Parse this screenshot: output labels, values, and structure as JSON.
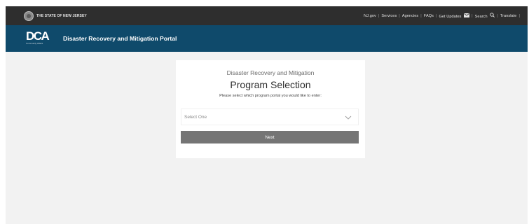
{
  "top_bar": {
    "state_name": "The State of New Jersey",
    "links": [
      "NJ.gov",
      "Services",
      "Agencies",
      "FAQs",
      "Get Updates",
      "Search",
      "Translate"
    ],
    "separator": "|",
    "icons": {
      "seal": "nj-state-seal-icon",
      "updates": "mail-icon",
      "search": "search-icon"
    }
  },
  "header": {
    "logo_text": "DCA",
    "logo_subtext": "Community Affairs",
    "title": "Disaster Recovery and Mitigation Portal"
  },
  "card": {
    "subtitle": "Disaster Recovery and Mitigation",
    "title": "Program Selection",
    "instruction": "Please select which program portal you would like to enter:",
    "select": {
      "value": "Select One",
      "icon": "chevron-down-icon"
    },
    "next_label": "Next"
  },
  "colors": {
    "top_bar_bg": "#2e2e2e",
    "header_bg": "#0f4a6b",
    "page_bg": "#f2f2f2",
    "button_bg": "#757575"
  }
}
